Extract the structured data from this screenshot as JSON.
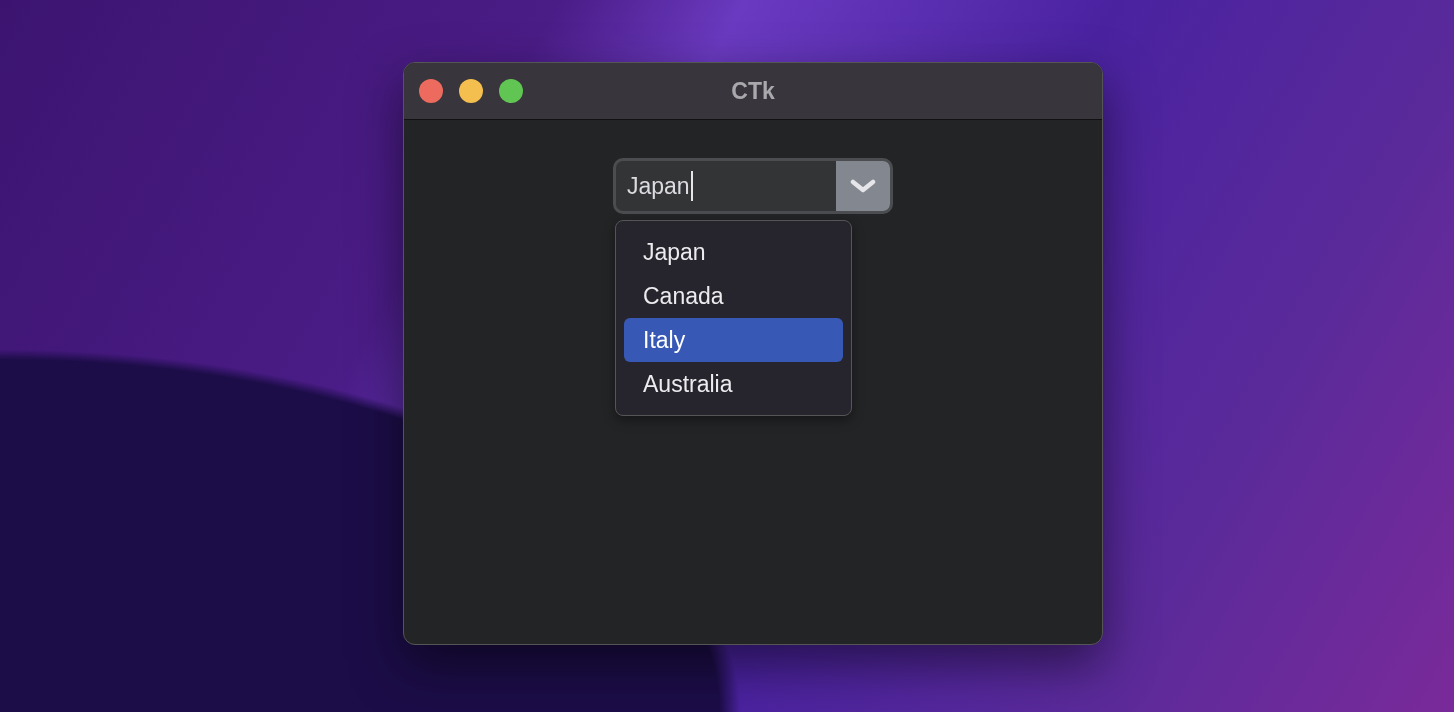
{
  "window": {
    "title": "CTk"
  },
  "combobox": {
    "value": "Japan",
    "focused": true,
    "expanded": true,
    "options": [
      {
        "label": "Japan",
        "highlighted": false
      },
      {
        "label": "Canada",
        "highlighted": false
      },
      {
        "label": "Italy",
        "highlighted": true
      },
      {
        "label": "Australia",
        "highlighted": false
      }
    ]
  }
}
